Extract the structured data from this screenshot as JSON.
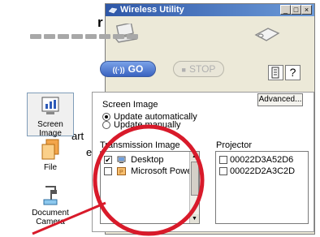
{
  "background": {
    "fragment_top": "r",
    "fragment_mid1": "art",
    "fragment_mid2": "e"
  },
  "window": {
    "title": "Wireless Utility",
    "controls": {
      "minimize": "_",
      "maximize": "□",
      "close": "×"
    }
  },
  "toolbar": {
    "go_label": "GO",
    "stop_label": "STOP",
    "help_label": "?"
  },
  "sidebar": {
    "items": [
      {
        "label": "Screen Image",
        "icon": "screen-image-icon"
      },
      {
        "label": "File",
        "icon": "file-icon"
      },
      {
        "label": "Document Camera",
        "icon": "document-camera-icon"
      }
    ]
  },
  "panel": {
    "title": "Screen Image",
    "advanced_label": "Advanced...",
    "radio_auto": "Update automatically",
    "radio_manual": "Update manually",
    "transmission_label": "Transmission Image",
    "projector_label": "Projector",
    "transmission_items": [
      {
        "label": "Desktop",
        "checked": true
      },
      {
        "label": "Microsoft Power",
        "checked": false
      }
    ],
    "projector_items": [
      {
        "label": "00022D3A52D6",
        "checked": false
      },
      {
        "label": "00022D2A3C2D",
        "checked": false
      }
    ]
  },
  "colors": {
    "title_bar": "#2e57a8",
    "go_button": "#4a74cc",
    "callout": "#d81a2a"
  }
}
